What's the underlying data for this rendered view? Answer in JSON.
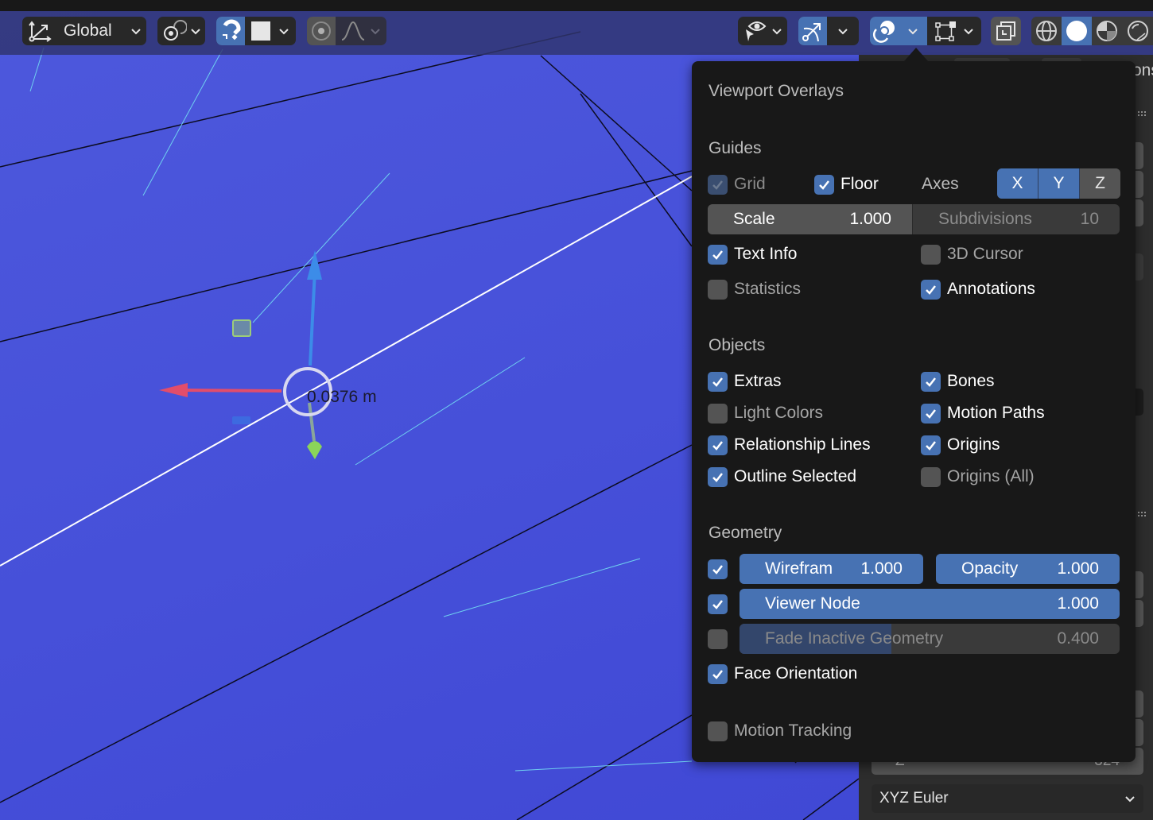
{
  "toolbar": {
    "orientation": {
      "label": "Global",
      "icon": "transform-orientation-icon"
    },
    "pivot": {
      "icon": "pivot-point-icon"
    },
    "snap": {
      "icon": "magnet-icon",
      "active": true,
      "target_icon": "snap-increment-icon"
    },
    "proportional": {
      "icon": "proportional-edit-icon",
      "falloff_icon": "falloff-curve-icon"
    },
    "visibility": {
      "icon": "selectability-visibility-icon"
    },
    "gizmo": {
      "icon": "gizmo-icon",
      "active": true
    },
    "overlays": {
      "icon": "overlays-icon",
      "active": true
    },
    "mesh_edit_overlays": {
      "icon": "mesh-edit-overlay-icon"
    },
    "xray": {
      "icon": "xray-icon"
    },
    "shading": [
      {
        "name": "wireframe",
        "icon": "wireframe-shading-icon",
        "active": false
      },
      {
        "name": "solid",
        "icon": "solid-shading-icon",
        "active": true
      },
      {
        "name": "material",
        "icon": "material-preview-icon",
        "active": false
      },
      {
        "name": "rendered",
        "icon": "rendered-shading-icon",
        "active": false
      }
    ]
  },
  "viewport": {
    "measure_text": "0.0376 m",
    "colors": {
      "x_axis": "#e24d6b",
      "y_axis": "#8bd45a",
      "z_axis": "#3c8ce8",
      "background": "#4650d9"
    }
  },
  "overlay_panel": {
    "title": "Viewport Overlays",
    "guides": {
      "title": "Guides",
      "grid": {
        "label": "Grid",
        "checked": true,
        "enabled": false
      },
      "floor": {
        "label": "Floor",
        "checked": true
      },
      "axes_label": "Axes",
      "axes": [
        {
          "label": "X",
          "on": true
        },
        {
          "label": "Y",
          "on": true
        },
        {
          "label": "Z",
          "on": false
        }
      ],
      "scale": {
        "label": "Scale",
        "value": "1.000"
      },
      "subdivisions": {
        "label": "Subdivisions",
        "value": "10"
      },
      "text_info": {
        "label": "Text Info",
        "checked": true
      },
      "cursor_3d": {
        "label": "3D Cursor",
        "checked": false
      },
      "statistics": {
        "label": "Statistics",
        "checked": false
      },
      "annotations": {
        "label": "Annotations",
        "checked": true
      }
    },
    "objects": {
      "title": "Objects",
      "extras": {
        "label": "Extras",
        "checked": true
      },
      "bones": {
        "label": "Bones",
        "checked": true
      },
      "light_colors": {
        "label": "Light Colors",
        "checked": false
      },
      "motion_paths": {
        "label": "Motion Paths",
        "checked": true
      },
      "relationship_lines": {
        "label": "Relationship Lines",
        "checked": true
      },
      "origins": {
        "label": "Origins",
        "checked": true
      },
      "outline_selected": {
        "label": "Outline Selected",
        "checked": true
      },
      "origins_all": {
        "label": "Origins (All)",
        "checked": false
      }
    },
    "geometry": {
      "title": "Geometry",
      "wireframe": {
        "checked": true,
        "label": "Wirefram",
        "value": "1.000",
        "fraction": 1.0
      },
      "opacity": {
        "label": "Opacity",
        "value": "1.000",
        "fraction": 1.0
      },
      "viewer_node": {
        "checked": true,
        "label": "Viewer Node",
        "value": "1.000",
        "fraction": 1.0
      },
      "fade_inactive": {
        "checked": false,
        "label": "Fade Inactive Geometry",
        "value": "0.400",
        "fraction": 0.4
      },
      "face_orientation": {
        "label": "Face Orientation",
        "checked": true
      }
    },
    "motion_tracking": {
      "label": "Motion Tracking",
      "checked": false
    }
  },
  "sidebar": {
    "partial_tab_text": "ons",
    "rotation_z_label": "Z",
    "rotation_z_value_partial": "324",
    "rotation_mode": "XYZ Euler"
  }
}
